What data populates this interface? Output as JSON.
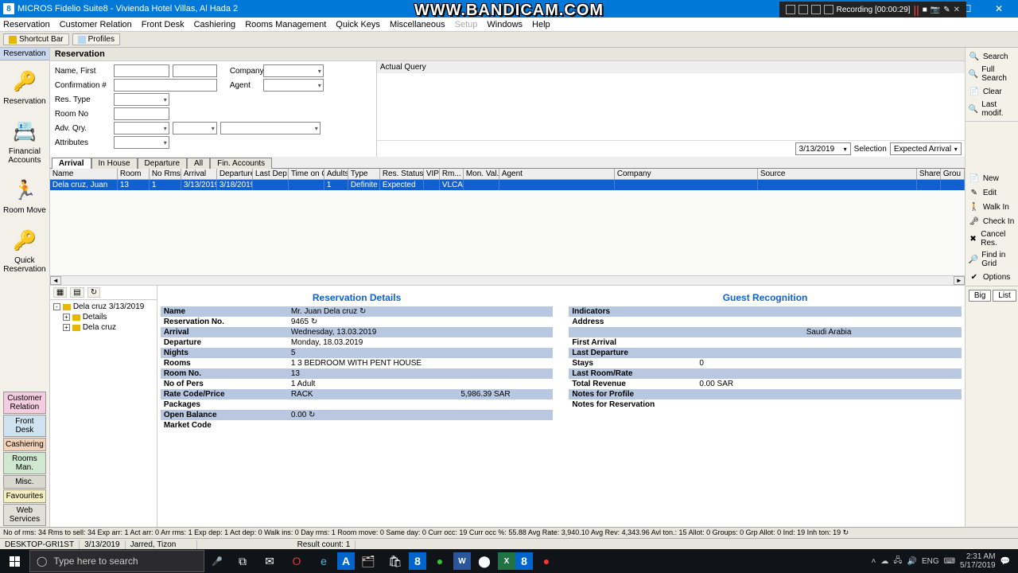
{
  "bandicam": {
    "logo": "WWW.BANDICAM.COM",
    "recording": "Recording [00:00:29]"
  },
  "title": "MICROS Fidelio Suite8 - Vivienda Hotel Villas, Al Hada 2",
  "menu": [
    "Reservation",
    "Customer Relation",
    "Front Desk",
    "Cashiering",
    "Rooms Management",
    "Quick Keys",
    "Miscellaneous",
    "Setup",
    "Windows",
    "Help"
  ],
  "toolbar": {
    "shortcut": "Shortcut Bar",
    "profiles": "Profiles"
  },
  "sidebar": {
    "header": "Reservation",
    "items": [
      {
        "label": "Reservation",
        "icon": "🔑"
      },
      {
        "label": "Financial Accounts",
        "icon": "📇"
      },
      {
        "label": "Room Move",
        "icon": "🏃"
      },
      {
        "label": "Quick Reservation",
        "icon": "🔑"
      }
    ],
    "bottom": [
      "Customer Relation",
      "Front Desk",
      "Cashiering",
      "Rooms Man.",
      "Misc.",
      "Favourites",
      "Web Services"
    ]
  },
  "content": {
    "header": "Reservation",
    "form": {
      "name_label": "Name, First",
      "company_label": "Company",
      "conf_label": "Confirmation #",
      "agent_label": "Agent",
      "restype_label": "Res. Type",
      "roomno_label": "Room No",
      "advqry_label": "Adv. Qry.",
      "attr_label": "Attributes"
    },
    "query_label": "Actual Query",
    "date_value": "3/13/2019",
    "selection_label": "Selection",
    "selection_value": "Expected Arrival",
    "tabs": [
      "Arrival",
      "In House",
      "Departure",
      "All",
      "Fin. Accounts"
    ],
    "grid_headers": [
      "Name",
      "Room",
      "No Rms",
      "Arrival",
      "Departure",
      "Last Dep.",
      "Time on Q",
      "Adults",
      "Type",
      "Res. Status",
      "VIP",
      "Rm...",
      "Mon. Val...",
      "Agent",
      "Company",
      "Source",
      "Share",
      "Grou"
    ],
    "grid_row": [
      "Dela cruz, Juan",
      "13",
      "1",
      "3/13/2019",
      "3/18/2019",
      "",
      "",
      "1",
      "Definite",
      "Expected",
      "",
      "VLCA",
      "",
      "",
      "",
      "",
      "",
      ""
    ]
  },
  "tree": {
    "root": "Dela cruz 3/13/2019",
    "children": [
      "Details",
      "Dela cruz"
    ]
  },
  "details": {
    "title": "Reservation Details",
    "rows": [
      {
        "k": "Name",
        "v": "Mr. Juan Dela cruz ↻",
        "shade": true
      },
      {
        "k": "Reservation No.",
        "v": "9465 ↻",
        "shade": false
      },
      {
        "k": "Arrival",
        "v": "Wednesday, 13.03.2019",
        "shade": true
      },
      {
        "k": "Departure",
        "v": "Monday, 18.03.2019",
        "shade": false
      },
      {
        "k": "Nights",
        "v": "5",
        "shade": true
      },
      {
        "k": "Rooms",
        "v": "1 3 BEDROOM WITH PENT HOUSE",
        "shade": false
      },
      {
        "k": "Room No.",
        "v": "13",
        "shade": true
      },
      {
        "k": "No of Pers",
        "v": "1 Adult",
        "shade": false
      },
      {
        "k": "Rate Code/Price",
        "v": "RACK",
        "v2": "5,986.39 SAR",
        "shade": true
      },
      {
        "k": "Packages",
        "v": "",
        "shade": false
      },
      {
        "k": "Open Balance",
        "v": "0.00 ↻",
        "shade": true
      },
      {
        "k": "Market Code",
        "v": "",
        "shade": false
      }
    ]
  },
  "guest": {
    "title": "Guest Recognition",
    "rows": [
      {
        "k": "Indicators",
        "v": "",
        "shade": true
      },
      {
        "k": "Address",
        "v": "",
        "shade": false
      },
      {
        "k": "",
        "v": "Saudi Arabia",
        "shade": true,
        "center": true
      },
      {
        "k": "First Arrival",
        "v": "",
        "shade": false
      },
      {
        "k": "Last Departure",
        "v": "",
        "shade": true
      },
      {
        "k": "Stays",
        "v": "0",
        "shade": false
      },
      {
        "k": "Last Room/Rate",
        "v": "",
        "shade": true
      },
      {
        "k": "Total Revenue",
        "v": "0.00 SAR",
        "shade": false
      },
      {
        "k": "Notes for Profile",
        "v": "",
        "shade": true
      },
      {
        "k": "Notes for Reservation",
        "v": "",
        "shade": false
      }
    ]
  },
  "actions": {
    "search": [
      "Search",
      "Full Search",
      "Clear",
      "Last modif."
    ],
    "ops": [
      "New",
      "Edit",
      "Walk In",
      "Check In",
      "Cancel Res.",
      "Find in Grid",
      "Options"
    ],
    "toggle": [
      "Big",
      "List"
    ]
  },
  "status1": "No of rms: 34   Rms to sell: 34   Exp arr: 1   Act arr: 0   Arr rms: 1   Exp dep: 1   Act dep: 0   Walk ins: 0   Day rms: 1   Room move: 0   Same day: 0   Curr occ: 19   Curr occ %: 55.88   Avg Rate: 3,940.10   Avg Rev: 4,343.96   Avl ton.: 15   Allot: 0   Groups: 0   Grp Allot: 0   Ind: 19   Inh ton: 19   ↻",
  "status2": {
    "desktop": "DESKTOP-GRI1ST",
    "date": "3/13/2019",
    "user": "Jarred, Tizon",
    "result": "Result count: 1"
  },
  "taskbar": {
    "search_placeholder": "Type here to search",
    "time": "2:31 AM",
    "date": "5/17/2019",
    "lang": "ENG"
  }
}
